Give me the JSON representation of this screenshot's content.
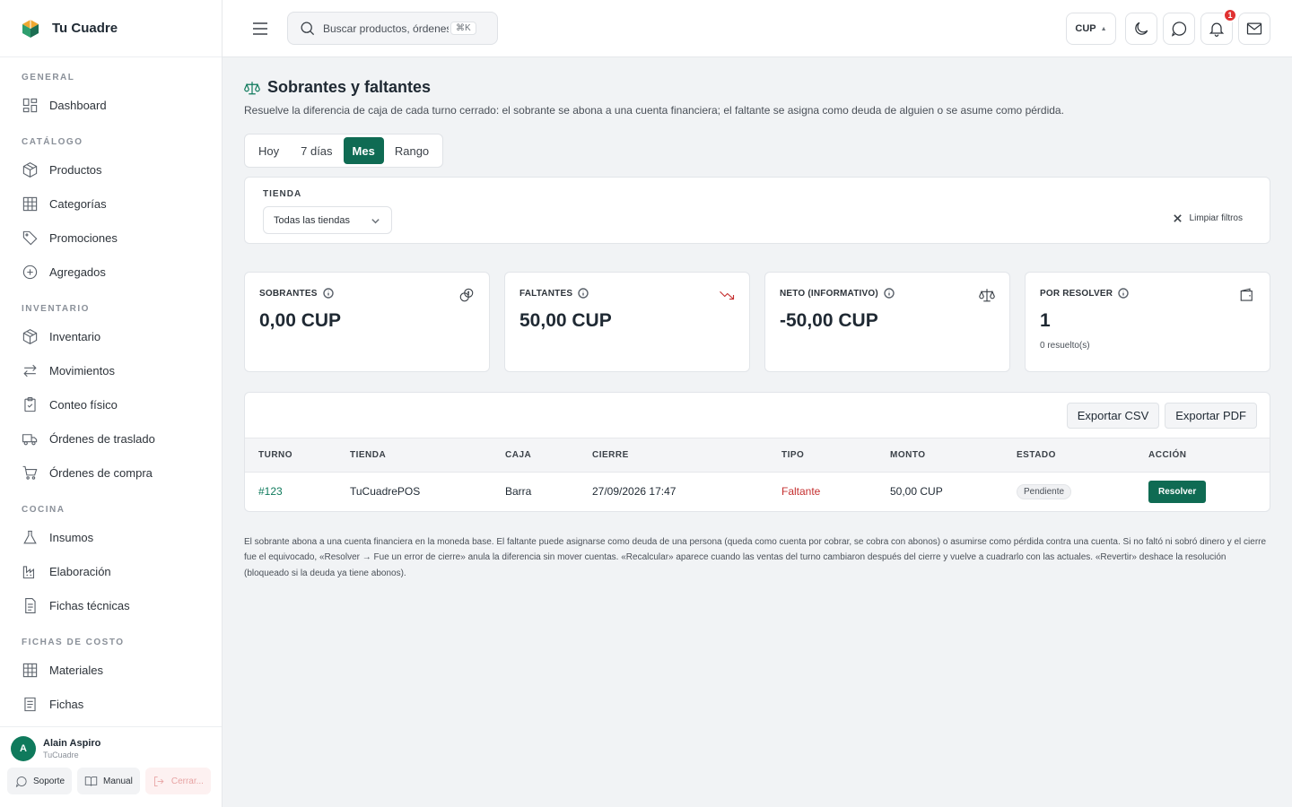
{
  "app": {
    "name": "Tu Cuadre"
  },
  "sidebar": {
    "sections": [
      {
        "title": "GENERAL",
        "items": [
          {
            "label": "Dashboard",
            "icon": "dashboard-icon"
          }
        ]
      },
      {
        "title": "CATÁLOGO",
        "items": [
          {
            "label": "Productos",
            "icon": "box-icon"
          },
          {
            "label": "Categorías",
            "icon": "grid-icon"
          },
          {
            "label": "Promociones",
            "icon": "tag-icon"
          },
          {
            "label": "Agregados",
            "icon": "plus-circle-icon"
          }
        ]
      },
      {
        "title": "INVENTARIO",
        "items": [
          {
            "label": "Inventario",
            "icon": "box-icon"
          },
          {
            "label": "Movimientos",
            "icon": "arrows-icon"
          },
          {
            "label": "Conteo físico",
            "icon": "clipboard-icon"
          },
          {
            "label": "Órdenes de traslado",
            "icon": "truck-icon"
          },
          {
            "label": "Órdenes de compra",
            "icon": "cart-icon"
          }
        ]
      },
      {
        "title": "COCINA",
        "items": [
          {
            "label": "Insumos",
            "icon": "flask-icon"
          },
          {
            "label": "Elaboración",
            "icon": "factory-icon"
          },
          {
            "label": "Fichas técnicas",
            "icon": "document-icon"
          }
        ]
      },
      {
        "title": "FICHAS DE COSTO",
        "items": [
          {
            "label": "Materiales",
            "icon": "grid-icon"
          },
          {
            "label": "Fichas",
            "icon": "document-icon"
          }
        ]
      }
    ],
    "user": {
      "initial": "A",
      "name": "Alain Aspiro",
      "org": "TuCuadre"
    },
    "footer": {
      "support": "Soporte",
      "manual": "Manual",
      "logout": "Cerrar..."
    }
  },
  "topbar": {
    "search_placeholder": "Buscar productos, órdenes…",
    "shortcut": "⌘K",
    "currency": "CUP",
    "notifications_count": "1"
  },
  "page": {
    "title": "Sobrantes y faltantes",
    "description": "Resuelve la diferencia de caja de cada turno cerrado: el sobrante se abona a una cuenta financiera; el faltante se asigna como deuda de alguien o se asume como pérdida.",
    "periods": [
      "Hoy",
      "7 días",
      "Mes",
      "Rango"
    ],
    "active_period": "Mes"
  },
  "filters": {
    "store_label": "TIENDA",
    "store_value": "Todas las tiendas",
    "clear_label": "Limpiar filtros"
  },
  "kpis": [
    {
      "label": "SOBRANTES",
      "value": "0,00 CUP",
      "icon": "coins-icon",
      "sub": ""
    },
    {
      "label": "FALTANTES",
      "value": "50,00 CUP",
      "icon": "trend-down-icon",
      "sub": ""
    },
    {
      "label": "NETO (INFORMATIVO)",
      "value": "-50,00 CUP",
      "icon": "scale-icon",
      "sub": ""
    },
    {
      "label": "POR RESOLVER",
      "value": "1",
      "icon": "wallet-icon",
      "sub": "0 resuelto(s)"
    }
  ],
  "table": {
    "export_csv": "Exportar CSV",
    "export_pdf": "Exportar PDF",
    "columns": [
      "TURNO",
      "TIENDA",
      "CAJA",
      "CIERRE",
      "TIPO",
      "MONTO",
      "ESTADO",
      "ACCIÓN"
    ],
    "rows": [
      {
        "turno": "#123",
        "tienda": "TuCuadrePOS",
        "caja": "Barra",
        "cierre": "27/09/2026 17:47",
        "tipo": "Faltante",
        "monto": "50,00 CUP",
        "estado": "Pendiente",
        "accion": "Resolver"
      }
    ]
  },
  "note": "El sobrante abona a una cuenta financiera en la moneda base. El faltante puede asignarse como deuda de una persona (queda como cuenta por cobrar, se cobra con abonos) o asumirse como pérdida contra una cuenta. Si no faltó ni sobró dinero y el cierre fue el equivocado, «Resolver → Fue un error de cierre» anula la diferencia sin mover cuentas. «Recalcular» aparece cuando las ventas del turno cambiaron después del cierre y vuelve a cuadrarlo con las actuales. «Revertir» deshace la resolución (bloqueado si la deuda ya tiene abonos).",
  "colors": {
    "accent": "#0f6b53",
    "danger": "#c53030",
    "badge": "#e03131"
  }
}
